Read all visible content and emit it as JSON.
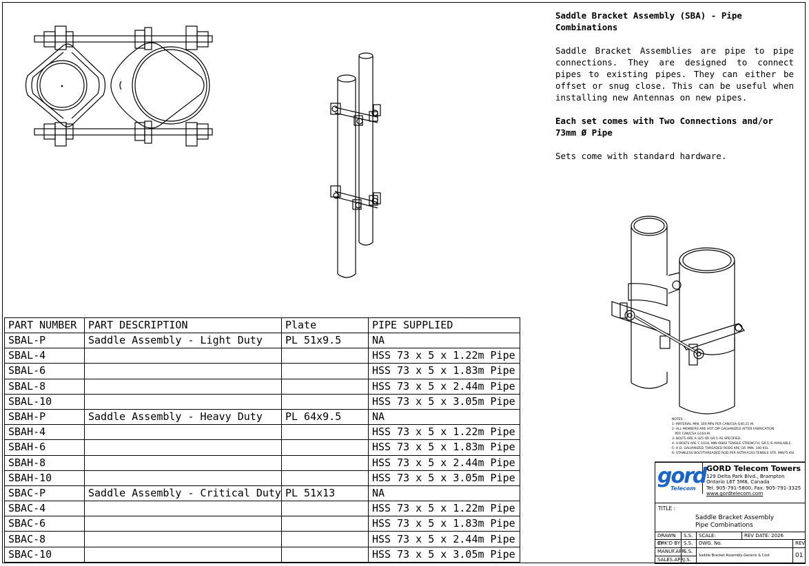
{
  "description": {
    "title": "Saddle Bracket Assembly (SBA) - Pipe Combinations",
    "paragraph": "Saddle Bracket Assemblies are pipe to pipe connections. They are designed to connect pipes to existing pipes. They can either be offset or snug close. This can be useful when installing new Antennas on new pipes.",
    "bold_note": "Each set comes with Two Connections and/or 73mm Ø Pipe",
    "hardware_note": "Sets come with standard hardware."
  },
  "parts_table": {
    "headers": [
      "PART NUMBER",
      "PART DESCRIPTION",
      "Plate",
      "PIPE SUPPLIED"
    ],
    "rows": [
      [
        "SBAL-P",
        "Saddle Assembly - Light Duty",
        "PL 51x9.5",
        "NA"
      ],
      [
        "SBAL-4",
        "",
        "",
        "HSS 73 x 5 x 1.22m Pipe"
      ],
      [
        "SBAL-6",
        "",
        "",
        "HSS 73 x 5 x 1.83m Pipe"
      ],
      [
        "SBAL-8",
        "",
        "",
        "HSS 73 x 5 x 2.44m Pipe"
      ],
      [
        "SBAL-10",
        "",
        "",
        "HSS 73 x 5 x 3.05m Pipe"
      ],
      [
        "SBAH-P",
        "Saddle Assembly - Heavy Duty",
        "PL 64x9.5",
        "NA"
      ],
      [
        "SBAH-4",
        "",
        "",
        "HSS 73 x 5 x 1.22m Pipe"
      ],
      [
        "SBAH-6",
        "",
        "",
        "HSS 73 x 5 x 1.83m Pipe"
      ],
      [
        "SBAH-8",
        "",
        "",
        "HSS 73 x 5 x 2.44m Pipe"
      ],
      [
        "SBAH-10",
        "",
        "",
        "HSS 73 x 5 x 3.05m Pipe"
      ],
      [
        "SBAC-P",
        "Saddle Assembly - Critical Duty",
        "PL 51x13",
        "NA"
      ],
      [
        "SBAC-4",
        "",
        "",
        "HSS 73 x 5 x 1.22m Pipe"
      ],
      [
        "SBAC-6",
        "",
        "",
        "HSS 73 x 5 x 1.83m Pipe"
      ],
      [
        "SBAC-8",
        "",
        "",
        "HSS 73 x 5 x 2.44m Pipe"
      ],
      [
        "SBAC-10",
        "",
        "",
        "HSS 73 x 5 x 3.05m Pipe"
      ]
    ]
  },
  "notes": {
    "heading": "NOTES :",
    "items": [
      "1- MATERIAL MIN. 300 MPa PER CAN/CSA-G40.21-M.",
      "2- ALL MEMBERS ARE HOT DIP GALVANIZED AFTER FABRICATION",
      "   PER CAN/CSA G164-M.",
      "3- BOLTS ARE A-325 OR GR-5 AS SPECIFIED.",
      "4- U-BOLTS ARE C-1018, MIN 66KSI TENSILE STRENGTH, GR.5 IS AVAILABLE.",
      "5- H.D. GALVANIZED THREADED RODS ARE GR. MIN. 100 KSI.",
      "6- STAINLESS BOLT/THREADED ROD PER ASTM-A193,TENSILE STR. MIN75 KSI."
    ]
  },
  "title_block": {
    "logo_text": "gord",
    "logo_sub": "Telecom",
    "company": "GORD Telecom Towers",
    "address_lines": [
      "129 Delta Park Blvd., Brampton",
      "Ontario L6T 5M8, Canada",
      "Tel. 905-791-5800, Fax. 905-791-3325",
      "www.gordtelecom.com"
    ],
    "title_label": "TITLE :",
    "title_lines": [
      "Saddle Bracket Assembly",
      "Pipe Combinations"
    ],
    "drawn_by_label": "DRAWN BY",
    "drawn_by": "S.S.",
    "chkd_by_label": "CHK'D BY",
    "chkd_by": "S.S.",
    "manuf_label": "MANUF.APR",
    "manuf": "S.S.",
    "sales_label": "SALES.APR",
    "sales": "J.S.",
    "scale_label": "SCALE:",
    "rev_date_label": "REV DATE:",
    "rev_date": "2026",
    "dwg_label": "DWG. No.",
    "dwg_name": "Saddle Bracket Assembly-Generic & Cost",
    "rev_label": "REV",
    "rev": "01"
  }
}
